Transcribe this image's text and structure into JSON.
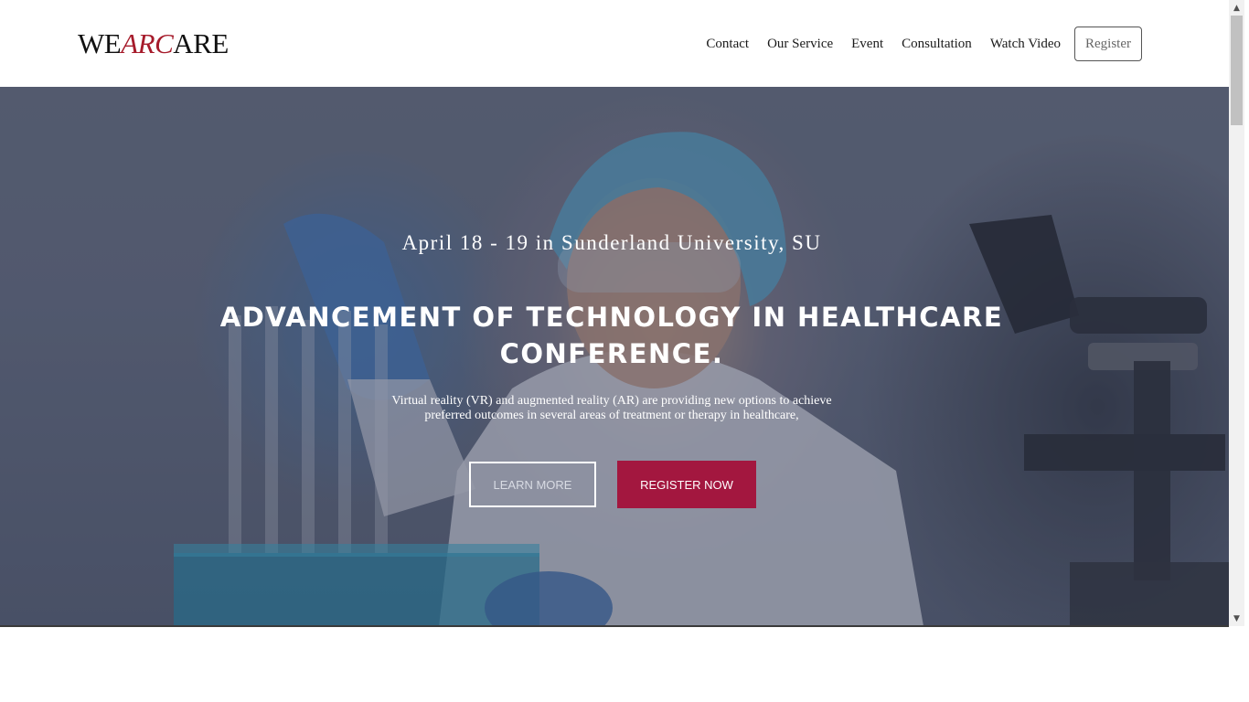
{
  "header": {
    "logo": {
      "part1": "WE",
      "part2": "ARC",
      "part3": "ARE"
    },
    "nav": [
      "Contact",
      "Our Service",
      "Event",
      "Consultation",
      "Watch Video"
    ],
    "register_label": "Register"
  },
  "hero": {
    "date_line": "April 18 - 19 in Sunderland University, SU",
    "title_line1": "ADVANCEMENT OF TECHNOLOGY IN HEALTHCARE",
    "title_line2": "CONFERENCE.",
    "description_line1": "Virtual reality (VR) and augmented reality (AR) are providing new options to achieve",
    "description_line2": "preferred outcomes in several areas of treatment or therapy in healthcare,",
    "learn_more_label": "LEARN MORE",
    "register_now_label": "REGISTER NOW"
  },
  "colors": {
    "brand_accent": "#a61b2b",
    "register_button": "#a3173f",
    "hero_overlay": "#283048"
  },
  "icons": {
    "scroll_up": "chevron-up-icon",
    "scroll_down": "chevron-down-icon"
  }
}
